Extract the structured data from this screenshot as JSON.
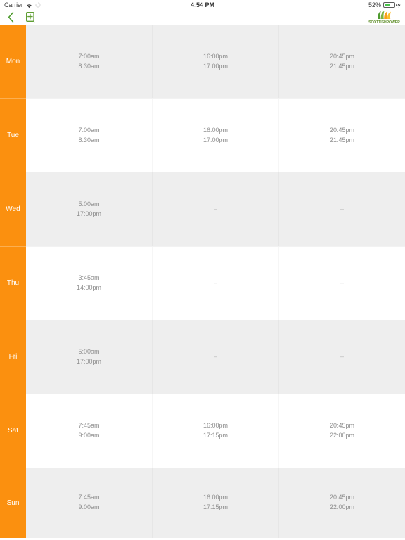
{
  "status_bar": {
    "carrier": "Carrier",
    "wifi_icon": "wifi-icon",
    "sync_icon": "sync-icon",
    "time": "4:54 PM",
    "battery_percent": "52%",
    "battery_level": 52,
    "battery_icon": "battery-icon",
    "charging_icon": "lightning-bolt-icon"
  },
  "navbar": {
    "back_icon": "chevron-left-icon",
    "save_icon": "save-document-icon",
    "brand_mark_icon": "scottishpower-flame-logo",
    "brand_name": "SCOTTISHPOWER"
  },
  "theme": {
    "accent_orange": "#fb900f",
    "brand_green": "#5f8f2a",
    "row_alt_background": "#eeeeee",
    "row_background": "#ffffff",
    "time_text_color": "#8e8e8e",
    "battery_green": "#49c34b"
  },
  "schedule": {
    "empty_value": "–",
    "rows": [
      {
        "day": "Mon",
        "slots": [
          {
            "start": "7:00am",
            "end": "8:30am"
          },
          {
            "start": "16:00pm",
            "end": "17:00pm"
          },
          {
            "start": "20:45pm",
            "end": "21:45pm"
          }
        ]
      },
      {
        "day": "Tue",
        "slots": [
          {
            "start": "7:00am",
            "end": "8:30am"
          },
          {
            "start": "16:00pm",
            "end": "17:00pm"
          },
          {
            "start": "20:45pm",
            "end": "21:45pm"
          }
        ]
      },
      {
        "day": "Wed",
        "slots": [
          {
            "start": "5:00am",
            "end": "17:00pm"
          },
          {
            "start": "–",
            "end": ""
          },
          {
            "start": "–",
            "end": ""
          }
        ]
      },
      {
        "day": "Thu",
        "slots": [
          {
            "start": "3:45am",
            "end": "14:00pm"
          },
          {
            "start": "–",
            "end": ""
          },
          {
            "start": "–",
            "end": ""
          }
        ]
      },
      {
        "day": "Fri",
        "slots": [
          {
            "start": "5:00am",
            "end": "17:00pm"
          },
          {
            "start": "–",
            "end": ""
          },
          {
            "start": "–",
            "end": ""
          }
        ]
      },
      {
        "day": "Sat",
        "slots": [
          {
            "start": "7:45am",
            "end": "9:00am"
          },
          {
            "start": "16:00pm",
            "end": "17:15pm"
          },
          {
            "start": "20:45pm",
            "end": "22:00pm"
          }
        ]
      },
      {
        "day": "Sun",
        "slots": [
          {
            "start": "7:45am",
            "end": "9:00am"
          },
          {
            "start": "16:00pm",
            "end": "17:15pm"
          },
          {
            "start": "20:45pm",
            "end": "22:00pm"
          }
        ]
      }
    ]
  }
}
